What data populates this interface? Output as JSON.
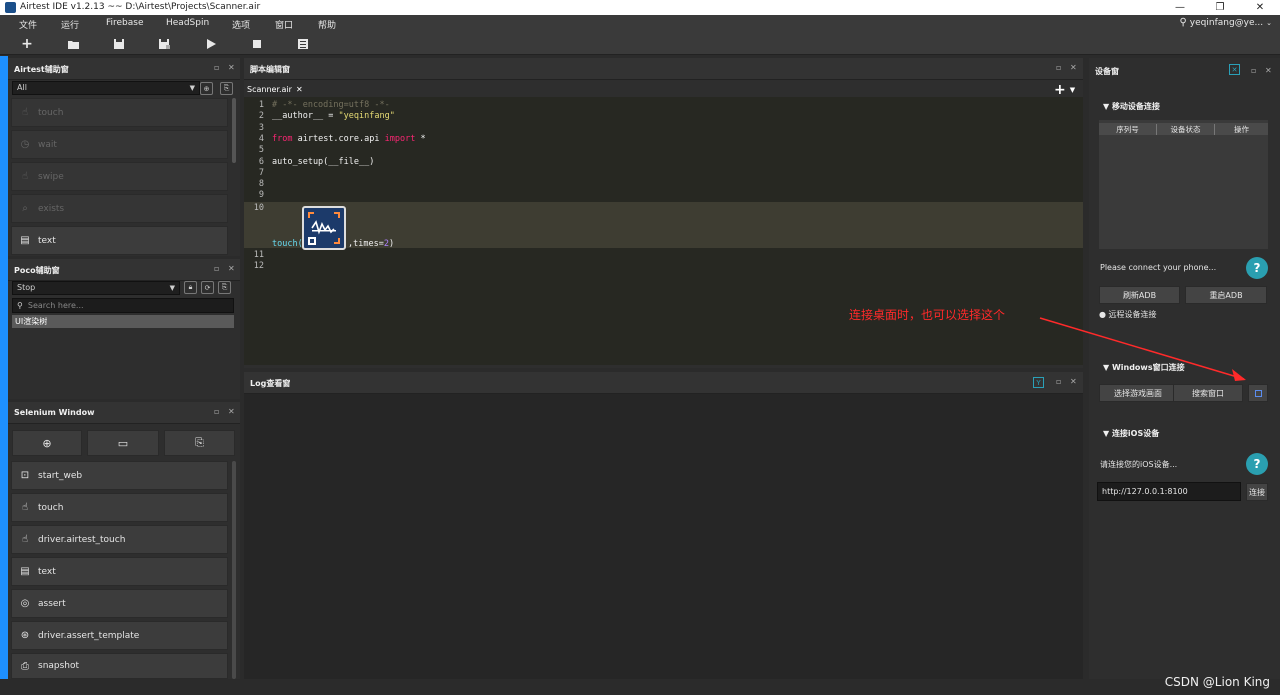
{
  "window": {
    "title": "Airtest IDE v1.2.13 ~~ D:\\Airtest\\Projects\\Scanner.air",
    "minimize": "—",
    "restore": "❐",
    "close": "✕"
  },
  "menu": {
    "items": [
      "文件",
      "运行",
      "Firebase",
      "HeadSpin",
      "选项",
      "窗口",
      "帮助"
    ],
    "user": "yeqinfang@ye..."
  },
  "toolbar": {
    "icons": [
      "plus-icon",
      "folder-open-icon",
      "save-icon",
      "save-as-icon",
      "play-icon",
      "stop-icon",
      "log-icon"
    ]
  },
  "airtest_panel": {
    "title": "Airtest辅助窗",
    "filter_value": "All",
    "commands": [
      {
        "label": "touch",
        "icon": "hand-icon",
        "enabled": false
      },
      {
        "label": "wait",
        "icon": "clock-icon",
        "enabled": false
      },
      {
        "label": "swipe",
        "icon": "swipe-icon",
        "enabled": false
      },
      {
        "label": "exists",
        "icon": "search-icon",
        "enabled": false
      },
      {
        "label": "text",
        "icon": "text-icon",
        "enabled": true
      }
    ]
  },
  "poco_panel": {
    "title": "Poco辅助窗",
    "mode_value": "Stop",
    "search_placeholder": "Search here...",
    "tree_item": "UI渲染树"
  },
  "selenium_panel": {
    "title": "Selenium Window",
    "commands": [
      {
        "label": "start_web",
        "icon": "browser-icon"
      },
      {
        "label": "touch",
        "icon": "hand-icon"
      },
      {
        "label": "driver.airtest_touch",
        "icon": "hand-icon"
      },
      {
        "label": "text",
        "icon": "text-icon"
      },
      {
        "label": "assert",
        "icon": "assert-icon"
      },
      {
        "label": "driver.assert_template",
        "icon": "assert-template-icon"
      },
      {
        "label": "snapshot",
        "icon": "camera-icon"
      }
    ]
  },
  "editor": {
    "panel_title": "脚本编辑窗",
    "tab_label": "Scanner.air",
    "tab_close": "✕",
    "lines": [
      {
        "n": "1",
        "segments": [
          {
            "t": "# -*- encoding=utf8 -*-",
            "c": "cm"
          }
        ]
      },
      {
        "n": "2",
        "segments": [
          {
            "t": "__author__ = ",
            "c": ""
          },
          {
            "t": "\"yeqinfang\"",
            "c": "str"
          }
        ]
      },
      {
        "n": "3",
        "segments": []
      },
      {
        "n": "4",
        "segments": [
          {
            "t": "from",
            "c": "kw"
          },
          {
            "t": " airtest.core.api ",
            "c": ""
          },
          {
            "t": "import",
            "c": "kw"
          },
          {
            "t": " *",
            "c": ""
          }
        ]
      },
      {
        "n": "5",
        "segments": []
      },
      {
        "n": "6",
        "segments": [
          {
            "t": "auto_setup(__file__)",
            "c": ""
          }
        ]
      },
      {
        "n": "7",
        "segments": []
      },
      {
        "n": "8",
        "segments": []
      },
      {
        "n": "9",
        "segments": []
      }
    ],
    "line10_number": "10",
    "line10_prefix": "touch(",
    "line10_suffix_kw": ",times=",
    "line10_suffix_num": "2",
    "line10_close": ")",
    "line11": "11",
    "line12": "12"
  },
  "log_panel": {
    "title": "Log查看窗"
  },
  "device_panel": {
    "title": "设备窗",
    "mobile_section": "▼ 移动设备连接",
    "table_headers": [
      "序列号",
      "设备状态",
      "操作"
    ],
    "connect_hint": "Please connect your phone...",
    "refresh_adb": "刷新ADB",
    "restart_adb": "重启ADB",
    "remote_connect": "● 远程设备连接",
    "windows_section": "▼ Windows窗口连接",
    "select_game": "选择游戏画面",
    "search_window": "搜索窗口",
    "ios_section": "▼ 连接iOS设备",
    "ios_hint": "请连接您的iOS设备...",
    "ios_url": "http://127.0.0.1:8100",
    "ios_connect": "连接"
  },
  "annotation": {
    "text": "连接桌面时，也可以选择这个",
    "color": "#ff2a2a"
  },
  "watermark": "CSDN @Lion King"
}
